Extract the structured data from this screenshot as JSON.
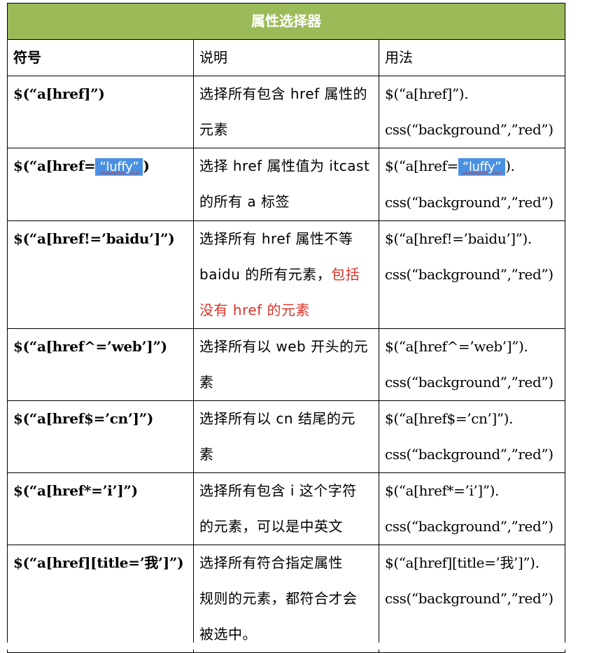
{
  "title": "属性选择器",
  "headers": {
    "symbol": "符号",
    "description": "说明",
    "usage": "用法"
  },
  "rows": [
    {
      "symbol": "$(“a[href]”)",
      "desc_lines": [
        "选择所有包含 href 属性的",
        "元素"
      ],
      "usage_lines": [
        "$(“a[href]”).",
        "css(“background”,”red”)"
      ]
    },
    {
      "symbol_prefix": "$(“a[href=",
      "symbol_highlight": "“luffy”",
      "symbol_suffix": ")",
      "desc_lines": [
        "选择 href 属性值为 itcast",
        "的所有 a 标签"
      ],
      "usage_prefix": "$(“a[href=",
      "usage_highlight": "“luffy”",
      "usage_suffix": ").",
      "usage_line2": "css(“background”,”red”)"
    },
    {
      "symbol": "$(“a[href!=’baidu’]”)",
      "desc_line1": "选择所有 href 属性不等",
      "desc_line2_black": "baidu 的所有元素，",
      "desc_line2_red": "包括",
      "desc_line3_red": "没有 href 的元素",
      "usage_lines": [
        "$(“a[href!=’baidu’]”).",
        "css(“background”,”red”)"
      ]
    },
    {
      "symbol": "$(“a[href^=’web’]”)",
      "desc_lines": [
        "选择所有以 web 开头的元",
        "素"
      ],
      "usage_lines": [
        "$(“a[href^=’web’]”).",
        "css(“background”,”red”)"
      ]
    },
    {
      "symbol": "$(“a[href$=’cn’]”)",
      "desc_lines": [
        "选择所有以 cn 结尾的元",
        "素"
      ],
      "usage_lines": [
        "$(“a[href$=’cn’]”).",
        "css(“background”,”red”)"
      ]
    },
    {
      "symbol": "$(“a[href*=’i’]”)",
      "desc_lines": [
        "选择所有包含 i 这个字符",
        "的元素，可以是中英文"
      ],
      "usage_lines": [
        "$(“a[href*=’i’]”).",
        "css(“background”,”red”)"
      ]
    },
    {
      "symbol": "$(“a[href][title=’我’]”)",
      "desc_lines": [
        "选择所有符合指定属性",
        "规则的元素，都符合才会",
        "被选中。"
      ],
      "usage_lines": [
        "$(“a[href][title=’我’]”).",
        "css(“background”,”red”)"
      ]
    }
  ],
  "colors": {
    "title_bg": "#9bbb59",
    "title_text": "#ffffff",
    "highlight_bg": "#4a90e2",
    "red_text": "#d9342b"
  }
}
